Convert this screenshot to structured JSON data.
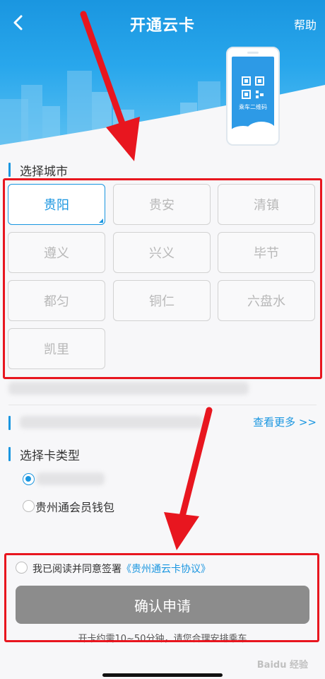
{
  "header": {
    "title": "开通云卡",
    "help": "帮助",
    "phone_label": "乘车二维码"
  },
  "city_section": {
    "title": "选择城市",
    "cities": [
      "贵阳",
      "贵安",
      "清镇",
      "遵义",
      "兴义",
      "毕节",
      "都匀",
      "铜仁",
      "六盘水",
      "凯里"
    ],
    "selected": "贵阳"
  },
  "more_link": "查看更多 >>",
  "card_type": {
    "title": "选择卡类型",
    "option_wallet": "贵州通会员钱包"
  },
  "agreement": {
    "text": "我已阅读并同意签署",
    "link": "《贵州通云卡协议》"
  },
  "confirm_button": "确认申请",
  "note": "开卡约需10~50分钟，请您合理安排乘车",
  "watermark": "Baidu 经验",
  "colors": {
    "accent": "#1a96e0",
    "annotation": "#e8161f",
    "button_disabled": "#8c8c8c"
  }
}
